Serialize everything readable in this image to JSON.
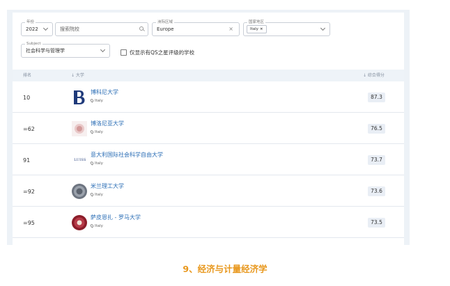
{
  "filters": {
    "year": {
      "legend": "年份",
      "value": "2022"
    },
    "search": {
      "placeholder": "搜索院校"
    },
    "region": {
      "legend": "洲际区域",
      "value": "Europe"
    },
    "country": {
      "legend": "国家地区",
      "chip": "Italy"
    },
    "subject": {
      "legend": "Subject",
      "value": "社会科学与管理学"
    },
    "qs_only_label": "仅显示有QS之星评级的学校"
  },
  "table": {
    "col_rank": "排名",
    "col_university": "↓ 大学",
    "col_score": "↓ 综合得分",
    "rows": [
      {
        "rank": "10",
        "name": "博科尼大学",
        "country": "Italy",
        "score": "87.3",
        "logo": "bocconi-logo"
      },
      {
        "rank": "=62",
        "name": "博洛尼亚大学",
        "country": "Italy",
        "score": "76.5",
        "logo": "bologna-logo"
      },
      {
        "rank": "91",
        "name": "意大利国际社会科学自由大学",
        "country": "Italy",
        "score": "73.7",
        "logo": "luiss-logo"
      },
      {
        "rank": "=92",
        "name": "米兰理工大学",
        "country": "Italy",
        "score": "73.6",
        "logo": "polimi-logo"
      },
      {
        "rank": "=95",
        "name": "萨皮恩扎 - 罗马大学",
        "country": "Italy",
        "score": "73.5",
        "logo": "sapienza-logo"
      }
    ]
  },
  "logos": {
    "luiss_text": "LUISS"
  },
  "footer": {
    "title": "9、经济与计量经济学"
  },
  "colors": {
    "accent": "#2a6db5",
    "footer": "#e8971c",
    "panel_bg": "#edf2f7"
  }
}
